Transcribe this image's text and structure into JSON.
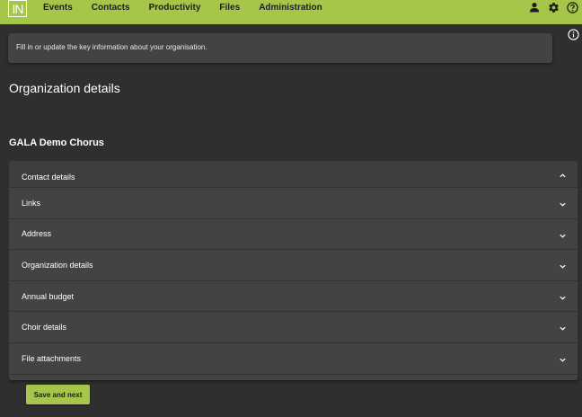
{
  "app": {
    "logo_text": "IN"
  },
  "nav": {
    "items": [
      "Events",
      "Contacts",
      "Productivity",
      "Files",
      "Administration"
    ]
  },
  "top_icons": [
    "user-icon",
    "gear-icon",
    "help-icon"
  ],
  "info": {
    "text": "Fill in or update the key information about your organisation."
  },
  "page": {
    "title": "Organization details",
    "org_name": "GALA Demo Chorus"
  },
  "accordion": {
    "sections": [
      {
        "label": "Contact details",
        "expanded": true
      },
      {
        "label": "Links",
        "expanded": false
      },
      {
        "label": "Address",
        "expanded": false
      },
      {
        "label": "Organization details",
        "expanded": false
      },
      {
        "label": "Annual budget",
        "expanded": false
      },
      {
        "label": "Choir details",
        "expanded": false
      },
      {
        "label": "File attachments",
        "expanded": false
      }
    ]
  },
  "actions": {
    "save_next_label": "Save and next"
  },
  "colors": {
    "accent": "#a6c64a",
    "background": "#2f2f2f",
    "panel": "#434343"
  }
}
